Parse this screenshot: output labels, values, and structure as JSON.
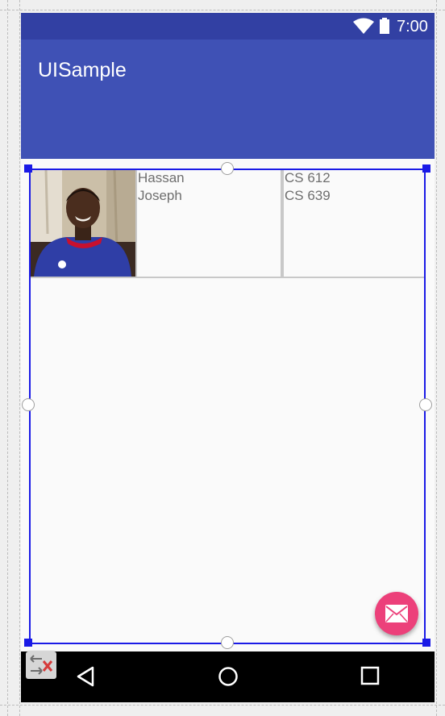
{
  "status_bar": {
    "time": "7:00",
    "wifi_icon": "wifi-icon",
    "battery_icon": "battery-icon"
  },
  "app_bar": {
    "title": "UISample"
  },
  "table": {
    "row": {
      "photo_icon": "person-photo",
      "name_lines": [
        "Hassan",
        "Joseph"
      ],
      "course_lines": [
        "CS 612",
        "CS 639"
      ]
    }
  },
  "fab": {
    "icon": "mail-icon",
    "color": "#ec407a"
  },
  "nav_bar": {
    "back_icon": "back-triangle-icon",
    "home_icon": "home-circle-icon",
    "recents_icon": "recents-square-icon"
  },
  "editor": {
    "convert_icon": "convert-view-icon"
  },
  "colors": {
    "primary": "#3f51b5",
    "primary_dark": "#3240a3",
    "accent": "#ec407a",
    "selection": "#1a1ae6"
  }
}
